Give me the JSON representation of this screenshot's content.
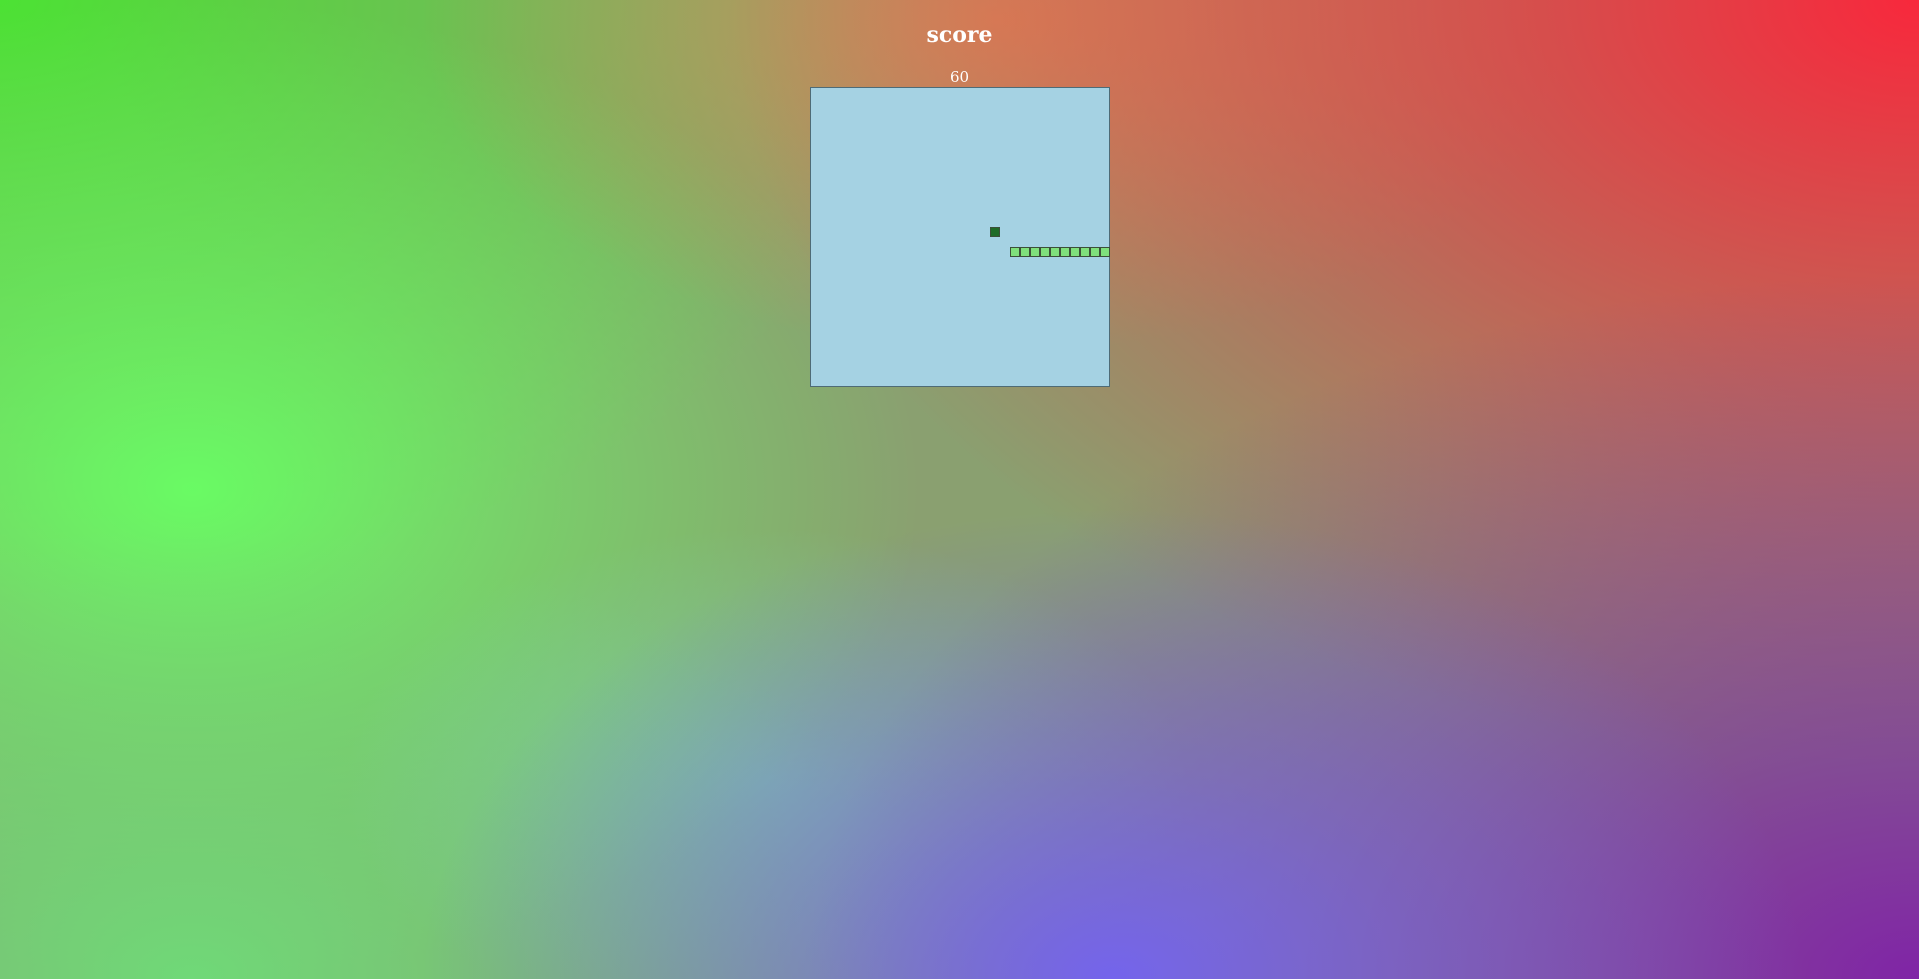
{
  "header": {
    "title": "score",
    "score": "60"
  },
  "board": {
    "cols": 30,
    "rows": 30,
    "background": "#a5d2e3",
    "food": {
      "col": 18,
      "row": 14,
      "color": "#1f6b27"
    },
    "snake": {
      "color": "#7fe07c",
      "segments": [
        [
          20,
          16
        ],
        [
          21,
          16
        ],
        [
          22,
          16
        ],
        [
          23,
          16
        ],
        [
          24,
          16
        ],
        [
          25,
          16
        ],
        [
          26,
          16
        ],
        [
          27,
          16
        ],
        [
          28,
          16
        ],
        [
          29,
          16
        ]
      ]
    }
  },
  "colors": {
    "text": "#ffffff",
    "board_border": "#4e6b76",
    "cell_border": "#3b4f3a"
  }
}
